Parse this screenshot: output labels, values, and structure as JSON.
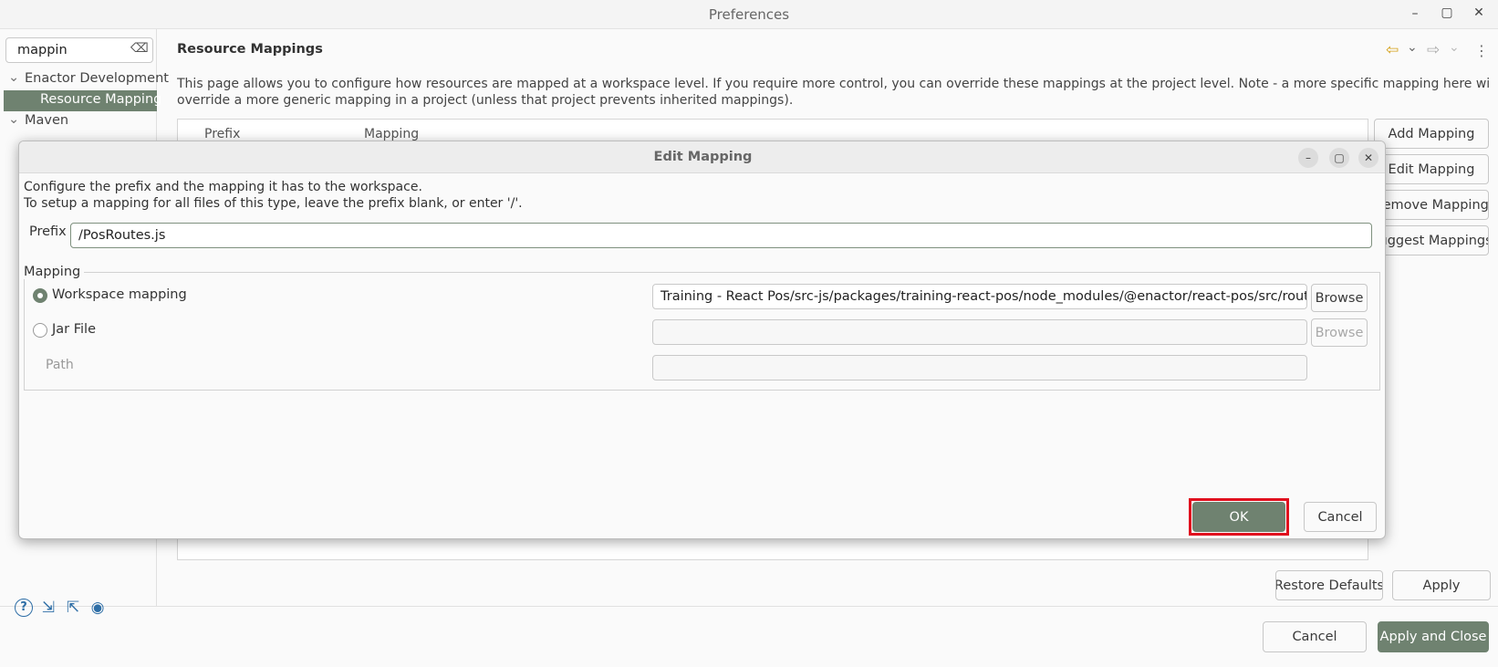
{
  "window": {
    "title": "Preferences",
    "minimize": "–",
    "maximize": "▢",
    "close": "✕"
  },
  "filter": {
    "value": "mappin",
    "clear_glyph": "⌫"
  },
  "tree": {
    "items": [
      {
        "label": "Enactor Development",
        "chevron": "⌄"
      },
      {
        "label": "Resource Mapping"
      },
      {
        "label": "Maven",
        "chevron": "⌄"
      }
    ]
  },
  "page": {
    "title": "Resource Mappings",
    "description_line1": "This page allows you to configure how resources are mapped at a workspace level. If you require more control, you can override these mappings at the project level. Note - a more specific mapping here will always",
    "description_line2": "override a more generic mapping in a project (unless that project prevents inherited mappings).",
    "table_headers": [
      "Prefix",
      "Mapping"
    ],
    "buttons": {
      "add": "Add Mapping",
      "edit": "Edit Mapping",
      "remove": "Remove Mapping",
      "suggest": "Suggest Mappings",
      "restore_defaults": "Restore Defaults",
      "apply": "Apply"
    },
    "nav_icons": {
      "back": "⇦",
      "forward": "⇨",
      "dropdown": "⌄",
      "menu": "⋮"
    }
  },
  "footer": {
    "cancel": "Cancel",
    "apply_and_close": "Apply and Close",
    "icons": [
      "help-icon",
      "import-icon",
      "export-icon",
      "record-icon"
    ]
  },
  "dialog": {
    "title": "Edit Mapping",
    "controls": {
      "minimize": "–",
      "maximize": "▢",
      "close": "✕"
    },
    "instructions_line1": "Configure the prefix and the mapping it has to the workspace.",
    "instructions_line2": "To setup a mapping for all files of this type, leave the prefix blank, or enter '/'.",
    "prefix_label": "Prefix",
    "prefix_value": "/PosRoutes.js",
    "mapping_group_label": "Mapping",
    "workspace_radio_label": "Workspace mapping",
    "workspace_radio_selected": true,
    "workspace_path": "Training - React Pos/src-js/packages/training-react-pos/node_modules/@enactor/react-pos/src/routes/pos",
    "jar_radio_label": "Jar File",
    "jar_value": "",
    "path_label": "Path",
    "path_value": "",
    "browse_label": "Browse",
    "ok_label": "OK",
    "cancel_label": "Cancel",
    "highlight_color": "#e0101e"
  },
  "colors": {
    "accent": "#6f8270",
    "selection": "#6f8270"
  }
}
